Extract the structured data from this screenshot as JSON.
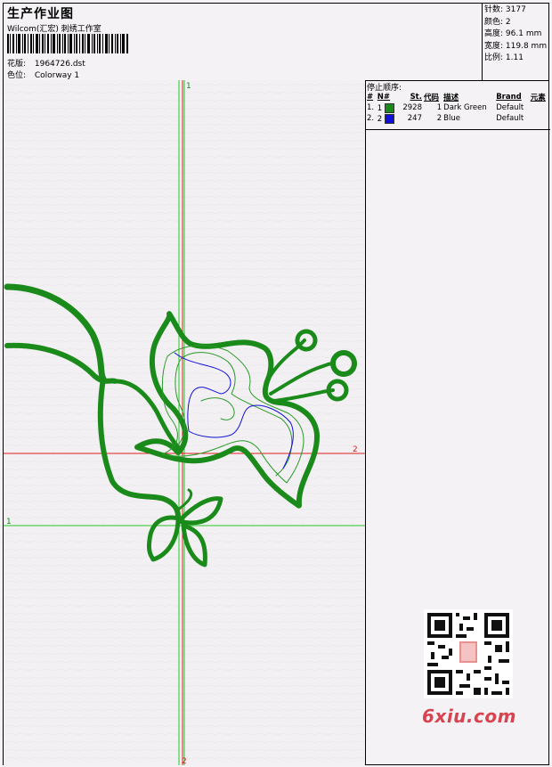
{
  "header": {
    "title": "生产作业图",
    "company": "Wilcom(汇宏) 刺绣工作室",
    "design_label": "花版:",
    "design_value": "1964726.dst",
    "colorway_label": "色位:",
    "colorway_value": "Colorway 1"
  },
  "stats": {
    "stitches_label": "针数:",
    "stitches_value": "3177",
    "colors_label": "颜色:",
    "colors_value": "2",
    "height_label": "高度:",
    "height_value": "96.1 mm",
    "width_label": "宽度:",
    "width_value": "119.8 mm",
    "scale_label": "比例:",
    "scale_value": "1.11"
  },
  "stop_sequence": {
    "title": "停止顺序:",
    "columns": [
      "#",
      "N#",
      "St.",
      "代码",
      "描述",
      "Brand",
      "元素"
    ],
    "rows": [
      {
        "index": "1.",
        "n": "1",
        "stitches": "2928",
        "code": "1",
        "desc": "Dark Green",
        "brand": "Default",
        "color": "#1a8a1a"
      },
      {
        "index": "2.",
        "n": "2",
        "stitches": "247",
        "code": "2",
        "desc": "Blue",
        "brand": "Default",
        "color": "#1010d8"
      }
    ]
  },
  "axes": {
    "green_top": "1",
    "green_left": "1",
    "red_right": "2",
    "red_bottom": "2",
    "green_color": "#28c828",
    "red_color": "#e02020"
  },
  "design_colors": {
    "primary": "#1a8a1a",
    "outline": "#2a9a2a",
    "blue": "#1010d8"
  },
  "watermark": "6xiu.com"
}
